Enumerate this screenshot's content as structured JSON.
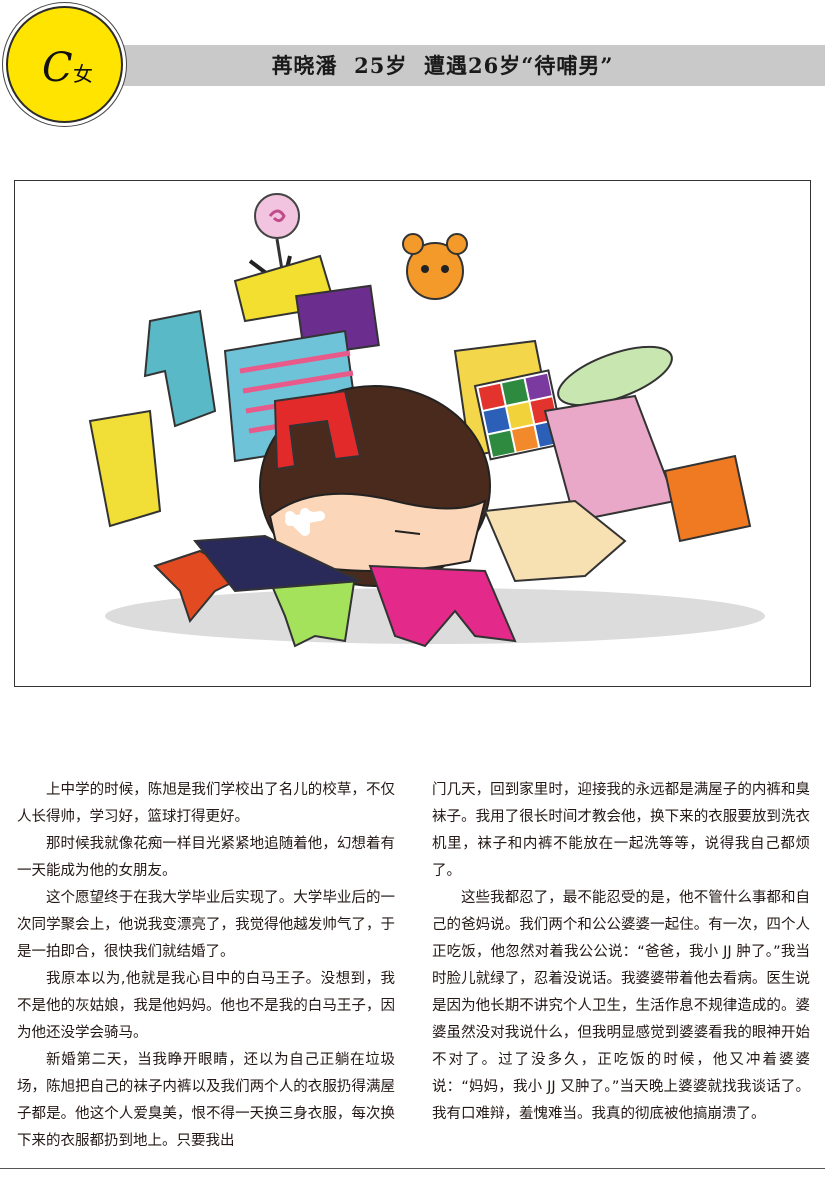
{
  "header": {
    "badge_letter": "C",
    "badge_gender": "女",
    "title": "苒晓潘  25岁  遭遇26岁“待哺男”",
    "bar_color": "#c9c9c9",
    "badge_color": "#ffe400"
  },
  "illustration": {
    "icon": "cartoon-girl-buried-under-pile-of-clothes-illustration"
  },
  "article": {
    "left_paragraphs": [
      "上中学的时候，陈旭是我们学校出了名儿的校草，不仅人长得帅，学习好，篮球打得更好。",
      "那时候我就像花痴一样目光紧紧地追随着他，幻想着有一天能成为他的女朋友。",
      "这个愿望终于在我大学毕业后实现了。大学毕业后的一次同学聚会上，他说我变漂亮了，我觉得他越发帅气了，于是一拍即合，很快我们就结婚了。",
      "我原本以为,他就是我心目中的白马王子。没想到，我不是他的灰姑娘，我是他妈妈。他也不是我的白马王子，因为他还没学会骑马。",
      "新婚第二天，当我睁开眼睛，还以为自己正躺在垃圾场，陈旭把自己的袜子内裤以及我们两个人的衣服扔得满屋子都是。他这个人爱臭美，恨不得一天换三身衣服，每次换下来的衣服都扔到地上。只要我出"
    ],
    "right_continuation": "门几天，回到家里时，迎接我的永远都是满屋子的内裤和臭袜子。我用了很长时间才教会他，换下来的衣服要放到洗衣机里，袜子和内裤不能放在一起洗等等，说得我自己都烦了。",
    "right_paragraphs": [
      "这些我都忍了，最不能忍受的是，他不管什么事都和自己的爸妈说。我们两个和公公婆婆一起住。有一次，四个人正吃饭，他忽然对着我公公说：“爸爸，我小 JJ 肿了。”我当时脸儿就绿了，忍着没说话。我婆婆带着他去看病。医生说是因为他长期不讲究个人卫生，生活作息不规律造成的。婆婆虽然没对我说什么，但我明显感觉到婆婆看我的眼神开始不对了。过了没多久，正吃饭的时候，他又冲着婆婆说：“妈妈，我小 JJ 又肿了。”当天晚上婆婆就找我谈话了。我有口难辩，羞愧难当。我真的彻底被他搞崩溃了。"
    ]
  }
}
